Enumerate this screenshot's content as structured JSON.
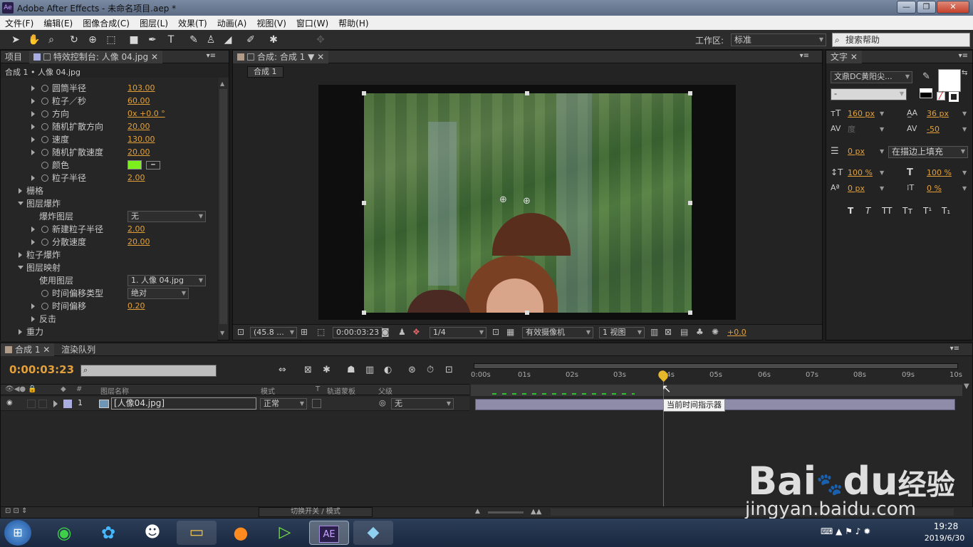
{
  "window": {
    "title": "Adobe After Effects - 未命名项目.aep *",
    "app_icon": "Ae",
    "min": "—",
    "max": "❐",
    "close": "✕"
  },
  "menu": [
    "文件(F)",
    "编辑(E)",
    "图像合成(C)",
    "图层(L)",
    "效果(T)",
    "动画(A)",
    "视图(V)",
    "窗口(W)",
    "帮助(H)"
  ],
  "toolbar": {
    "workspace_label": "工作区:",
    "workspace_value": "标准",
    "search_placeholder": "搜索帮助"
  },
  "left_panel": {
    "tab_project": "项目",
    "tab_effects": "特效控制台: 人像 04.jpg",
    "breadcrumb": "合成 1 • 人像 04.jpg",
    "props": [
      {
        "label": "圆筒半径",
        "value": "103.00"
      },
      {
        "label": "粒子／秒",
        "value": "60.00"
      },
      {
        "label": "方向",
        "value": "0x +0.0 °"
      },
      {
        "label": "随机扩散方向",
        "value": "20.00"
      },
      {
        "label": "速度",
        "value": "130.00"
      },
      {
        "label": "随机扩散速度",
        "value": "20.00"
      },
      {
        "label": "颜色",
        "value": ""
      },
      {
        "label": "粒子半径",
        "value": "2.00"
      }
    ],
    "group_grid": "栅格",
    "group_layer_explode": "图层爆炸",
    "explode_layer_label": "爆炸图层",
    "explode_layer_value": "无",
    "new_radius_label": "新建粒子半径",
    "new_radius_value": "2.00",
    "disperse_label": "分散速度",
    "disperse_value": "20.00",
    "group_particle_explode": "粒子爆炸",
    "group_layer_map": "图层映射",
    "use_layer_label": "使用图层",
    "use_layer_value": "1. 人像 04.jpg",
    "time_offset_type_label": "时间偏移类型",
    "time_offset_type_value": "绝对",
    "time_offset_label": "时间偏移",
    "time_offset_value": "0.20",
    "group_affect": "反击",
    "group_gravity": "重力"
  },
  "comp_panel": {
    "tab": "合成: 合成 1",
    "subtab": "合成 1",
    "zoom": "(45.8 ...",
    "timecode": "0:00:03:23",
    "resolution": "1/4",
    "camera": "有效摄像机",
    "views": "1 视图",
    "exposure": "+0.0"
  },
  "char_panel": {
    "tab": "文字",
    "font": "文鼎DC黄阳尖...",
    "style": "-",
    "size": "160 px",
    "leading": "36 px",
    "kerning": "度",
    "tracking": "-50",
    "stroke": "0 px",
    "stroke_mode": "在描边上填充",
    "vscale": "100 %",
    "hscale": "100 %",
    "baseline": "0 px",
    "tsume": "0 %",
    "styles": [
      "T",
      "T",
      "TT",
      "Tт",
      "T¹",
      "T₁"
    ]
  },
  "timeline": {
    "tab_comp": "合成 1",
    "tab_render": "渲染队列",
    "timecode": "0:00:03:23",
    "col_name": "图层名称",
    "col_mode": "模式",
    "col_t": "T",
    "col_trkmat": "轨道蒙板",
    "col_parent": "父级",
    "col_num": "#",
    "layer_num": "1",
    "layer_name": "[人像04.jpg]",
    "layer_mode": "正常",
    "layer_parent": "无",
    "ruler": [
      "0:00s",
      "01s",
      "02s",
      "03s",
      "04s",
      "05s",
      "06s",
      "07s",
      "08s",
      "09s",
      "10s"
    ],
    "tooltip": "当前时间指示器",
    "switch_mode": "切换开关 / 模式"
  },
  "taskbar": {
    "time": "19:28",
    "date": "2019/6/30",
    "ae_label": "AE"
  },
  "watermark": {
    "brand": "Bai",
    "brand2": "du",
    "cn": "经验",
    "url": "jingyan.baidu.com"
  }
}
